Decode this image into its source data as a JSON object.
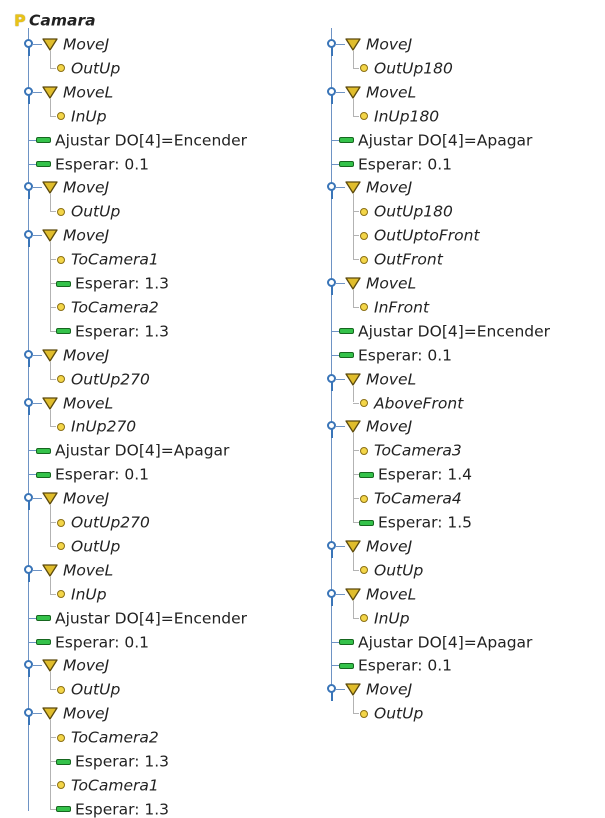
{
  "root_label": "Camara",
  "colors": {
    "accent_blue": "#3a75b8",
    "waypoint_yellow": "#f3d548",
    "action_green": "#34c24a"
  },
  "icons": {
    "root": "program-icon",
    "move": "move-triangle-icon",
    "waypoint": "waypoint-icon",
    "action": "action-dash-icon",
    "toggle": "expand-toggle-icon"
  },
  "left": [
    {
      "label": "MoveJ",
      "kind": "move",
      "children": [
        "OutUp"
      ]
    },
    {
      "label": "MoveL",
      "kind": "move",
      "children": [
        "InUp"
      ]
    },
    {
      "label": "Ajustar DO[4]=Encender",
      "kind": "action"
    },
    {
      "label": "Esperar: 0.1",
      "kind": "action"
    },
    {
      "label": "MoveJ",
      "kind": "move",
      "children": [
        "OutUp"
      ]
    },
    {
      "label": "MoveJ",
      "kind": "move",
      "children": [
        "ToCamera1",
        "Esperar: 1.3",
        "ToCamera2",
        "Esperar: 1.3"
      ]
    },
    {
      "label": "MoveJ",
      "kind": "move",
      "children": [
        "OutUp270"
      ]
    },
    {
      "label": "MoveL",
      "kind": "move",
      "children": [
        "InUp270"
      ]
    },
    {
      "label": "Ajustar DO[4]=Apagar",
      "kind": "action"
    },
    {
      "label": "Esperar: 0.1",
      "kind": "action"
    },
    {
      "label": "MoveJ",
      "kind": "move",
      "children": [
        "OutUp270",
        "OutUp"
      ]
    },
    {
      "label": "MoveL",
      "kind": "move",
      "children": [
        "InUp"
      ]
    },
    {
      "label": "Ajustar DO[4]=Encender",
      "kind": "action"
    },
    {
      "label": "Esperar: 0.1",
      "kind": "action"
    },
    {
      "label": "MoveJ",
      "kind": "move",
      "children": [
        "OutUp"
      ]
    },
    {
      "label": "MoveJ",
      "kind": "move",
      "children": [
        "ToCamera2",
        "Esperar: 1.3",
        "ToCamera1",
        "Esperar: 1.3"
      ]
    }
  ],
  "right": [
    {
      "label": "MoveJ",
      "kind": "move",
      "children": [
        "OutUp180"
      ]
    },
    {
      "label": "MoveL",
      "kind": "move",
      "children": [
        "InUp180"
      ]
    },
    {
      "label": "Ajustar DO[4]=Apagar",
      "kind": "action"
    },
    {
      "label": "Esperar: 0.1",
      "kind": "action"
    },
    {
      "label": "MoveJ",
      "kind": "move",
      "children": [
        "OutUp180",
        "OutUptoFront",
        "OutFront"
      ]
    },
    {
      "label": "MoveL",
      "kind": "move",
      "children": [
        "InFront"
      ]
    },
    {
      "label": "Ajustar DO[4]=Encender",
      "kind": "action"
    },
    {
      "label": "Esperar: 0.1",
      "kind": "action"
    },
    {
      "label": "MoveL",
      "kind": "move",
      "children": [
        "AboveFront"
      ]
    },
    {
      "label": "MoveJ",
      "kind": "move",
      "children": [
        "ToCamera3",
        "Esperar: 1.4",
        "ToCamera4",
        "Esperar: 1.5"
      ]
    },
    {
      "label": "MoveJ",
      "kind": "move",
      "children": [
        "OutUp"
      ]
    },
    {
      "label": "MoveL",
      "kind": "move",
      "children": [
        "InUp"
      ]
    },
    {
      "label": "Ajustar DO[4]=Apagar",
      "kind": "action"
    },
    {
      "label": "Esperar: 0.1",
      "kind": "action"
    },
    {
      "label": "MoveJ",
      "kind": "move",
      "children": [
        "OutUp"
      ]
    }
  ]
}
